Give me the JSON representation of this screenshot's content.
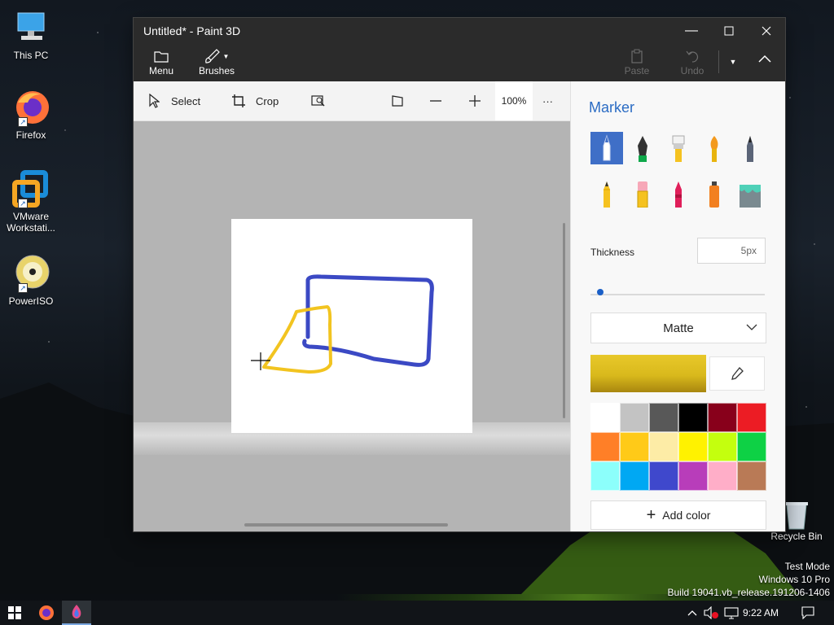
{
  "desktop": {
    "icons": [
      {
        "label": "This PC"
      },
      {
        "label": "Firefox"
      },
      {
        "label": "VMware Workstati..."
      },
      {
        "label": "PowerISO"
      }
    ],
    "recycle_bin": "Recycle Bin",
    "watermark": [
      "Test Mode",
      "Windows 10 Pro",
      "Build 19041.vb_release.191206-1406"
    ]
  },
  "window": {
    "title": "Untitled* - Paint 3D",
    "ribbon": {
      "menu_label": "Menu",
      "brushes_label": "Brushes",
      "paste_label": "Paste",
      "undo_label": "Undo"
    },
    "toolbar": {
      "select_label": "Select",
      "crop_label": "Crop",
      "zoom_level": "100%",
      "more_label": "···"
    }
  },
  "panel": {
    "title": "Marker",
    "brushes": [
      "marker",
      "calligraphy-pen",
      "oil-brush",
      "watercolor",
      "pixel-pen",
      "pencil",
      "eraser",
      "crayon",
      "spray-can",
      "fill"
    ],
    "thickness_label": "Thickness",
    "thickness_value": "5px",
    "thickness_level_percent": 3,
    "finish": "Matte",
    "current_color": "#e8c82a",
    "palette": [
      "#ffffff",
      "#c3c3c3",
      "#585858",
      "#000000",
      "#88001b",
      "#ec1c24",
      "#ff7f27",
      "#ffca18",
      "#fdeca6",
      "#fff200",
      "#c4ff0e",
      "#0ed145",
      "#8cfffb",
      "#00a8f3",
      "#3f48cc",
      "#b83dba",
      "#ffaec8",
      "#b97a56"
    ],
    "add_color_label": "Add color"
  },
  "taskbar": {
    "time": "9:22 AM"
  }
}
